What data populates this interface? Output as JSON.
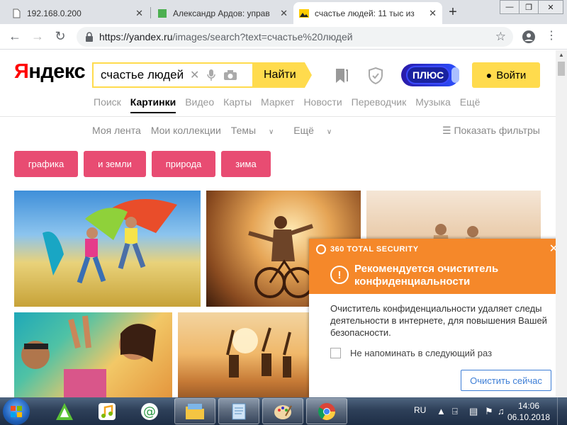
{
  "browser": {
    "tabs": [
      {
        "label": "192.168.0.200",
        "favicon": "page-icon"
      },
      {
        "label": "Александр Ардов: управ",
        "favicon": "green-square-icon"
      },
      {
        "label": "счастье людей: 11 тыс из",
        "favicon": "yandex-images-icon"
      }
    ],
    "active_tab": 2,
    "address": {
      "host": "https://yandex.ru",
      "path": "/images/search?text=счастье%20людей"
    }
  },
  "yandex": {
    "logo_first": "Я",
    "logo_rest": "ндекс",
    "search_value": "счастье людей",
    "find_label": "Найти",
    "plus_label": "ПЛЮС",
    "login_label": "Войти",
    "services": [
      "Поиск",
      "Картинки",
      "Видео",
      "Карты",
      "Маркет",
      "Новости",
      "Переводчик",
      "Музыка",
      "Ещё"
    ],
    "active_service": 1,
    "subnav": [
      "Моя лента",
      "Мои коллекции",
      "Темы",
      "Ещё"
    ],
    "filters_label": "Показать фильтры",
    "chips": [
      "графика",
      "и земли",
      "природа",
      "зима"
    ]
  },
  "popup": {
    "brand": "360 TOTAL SECURITY",
    "title": "Рекомендуется очиститель конфиденциальности",
    "body": "Очиститель конфиденциальности удаляет следы деятельности в интернете, для повышения Вашей безопасности.",
    "checkbox_label": "Не напоминать в следующий раз",
    "checkbox_checked": false,
    "button_label": "Очистить сейчас"
  },
  "taskbar": {
    "lang": "RU",
    "time": "14:06",
    "date": "06.10.2018"
  },
  "colors": {
    "yandex_yellow": "#ffdb4d",
    "chip_red": "#e84c72",
    "popup_orange": "#f5882a"
  }
}
